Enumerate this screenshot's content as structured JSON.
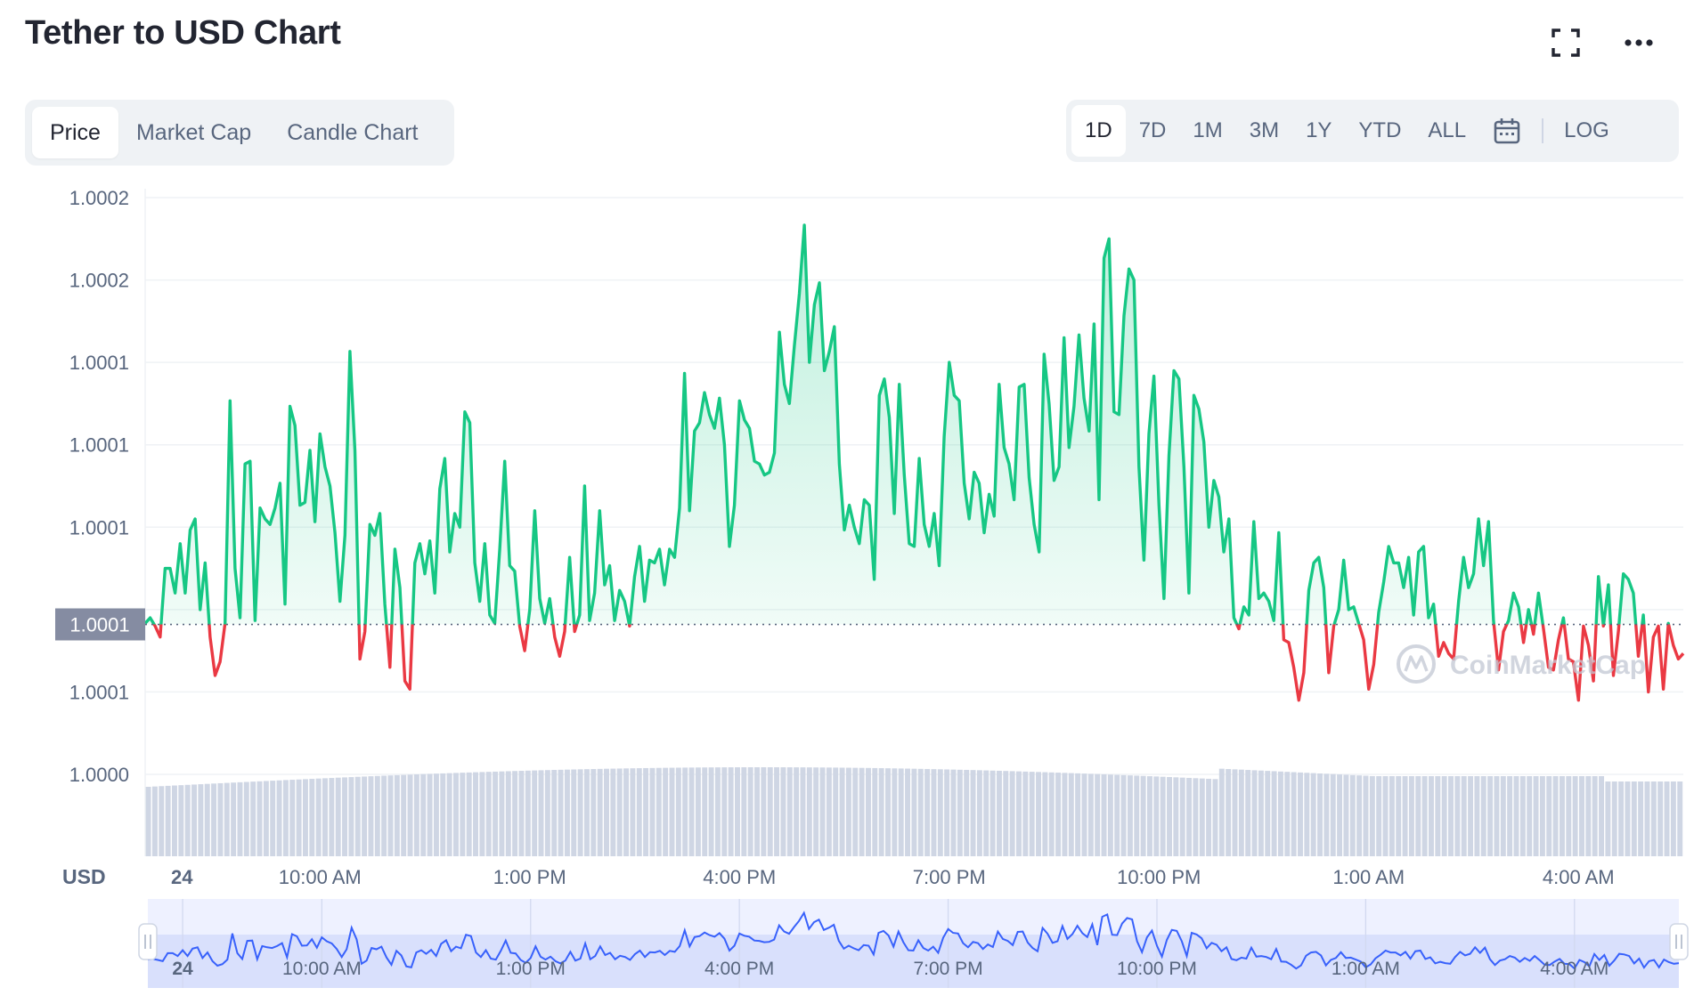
{
  "title": "Tether to USD Chart",
  "header_icons": [
    "fullscreen-icon",
    "more-options-icon"
  ],
  "tabs": [
    {
      "label": "Price",
      "active": true
    },
    {
      "label": "Market Cap",
      "active": false
    },
    {
      "label": "Candle Chart",
      "active": false
    }
  ],
  "ranges": [
    {
      "label": "1D",
      "active": true
    },
    {
      "label": "7D",
      "active": false
    },
    {
      "label": "1M",
      "active": false
    },
    {
      "label": "3M",
      "active": false
    },
    {
      "label": "1Y",
      "active": false
    },
    {
      "label": "YTD",
      "active": false
    },
    {
      "label": "ALL",
      "active": false
    }
  ],
  "range_icons": [
    "calendar-icon"
  ],
  "log_label": "LOG",
  "watermark": "CoinMarketCap",
  "colors": {
    "up": "#16c784",
    "down": "#ea3943",
    "navigator": "#3861fb",
    "volume": "#cfd6e4"
  },
  "chart_data": {
    "type": "line",
    "title": "Tether to USD Chart",
    "ylabel": "USD",
    "ylim": [
      1.0,
      1.00021
    ],
    "yticks": [
      1.0,
      1.00003,
      1.00006,
      1.00009,
      1.00012,
      1.00015,
      1.00018,
      1.00021
    ],
    "ytick_labels": [
      "1.0000",
      "1.0001",
      "",
      "1.0001",
      "1.0001",
      "1.0001",
      "1.0002",
      "1.0002"
    ],
    "baseline": 1.0000546,
    "baseline_label": "1.0001",
    "x_range": [
      7.5,
      29.5
    ],
    "x_ticks": [
      8,
      10,
      13,
      16,
      19,
      22,
      25,
      28
    ],
    "x_tick_labels": [
      "24",
      "10:00 AM",
      "1:00 PM",
      "4:00 PM",
      "7:00 PM",
      "10:00 PM",
      "1:00 AM",
      "4:00 AM"
    ],
    "grid": true,
    "series": [
      {
        "values": [
          1.000055,
          1.000057,
          1.000054,
          1.00005,
          1.000075,
          1.000075,
          1.000066,
          1.000084,
          1.000066,
          1.000089,
          1.000093,
          1.00006,
          1.000077,
          1.00005,
          1.000036,
          1.000041,
          1.000055,
          1.000136,
          1.000075,
          1.000057,
          1.000113,
          1.000114,
          1.000056,
          1.000097,
          1.000093,
          1.000091,
          1.000097,
          1.000106,
          1.000062,
          1.000134,
          1.000127,
          1.000098,
          1.000099,
          1.000118,
          1.000092,
          1.000124,
          1.000112,
          1.000105,
          1.000088,
          1.000063,
          1.000087,
          1.000154,
          1.000118,
          1.000042,
          1.000052,
          1.000091,
          1.000087,
          1.000095,
          1.000062,
          1.000039,
          1.000082,
          1.000068,
          1.000034,
          1.000031,
          1.000077,
          1.000084,
          1.000073,
          1.000085,
          1.000066,
          1.000104,
          1.000115,
          1.000081,
          1.000095,
          1.00009,
          1.000132,
          1.000128,
          1.000077,
          1.000063,
          1.000084,
          1.000058,
          1.000055,
          1.000082,
          1.000114,
          1.000076,
          1.000074,
          1.000054,
          1.000045,
          1.00006,
          1.000096,
          1.000064,
          1.000055,
          1.000064,
          1.00005,
          1.000043,
          1.000052,
          1.000079,
          1.000052,
          1.000058,
          1.000105,
          1.000056,
          1.000066,
          1.000096,
          1.000069,
          1.000076,
          1.000056,
          1.000067,
          1.000063,
          1.000054,
          1.000072,
          1.000083,
          1.000063,
          1.000078,
          1.000077,
          1.000082,
          1.000069,
          1.000082,
          1.000079,
          1.000097,
          1.000146,
          1.000096,
          1.000125,
          1.000128,
          1.000139,
          1.000131,
          1.000126,
          1.000137,
          1.00012,
          1.000083,
          1.000098,
          1.000136,
          1.000129,
          1.000126,
          1.000114,
          1.000113,
          1.000109,
          1.00011,
          1.000117,
          1.000161,
          1.000142,
          1.000135,
          1.000156,
          1.000175,
          1.0002,
          1.00015,
          1.000171,
          1.000179,
          1.000147,
          1.000154,
          1.000163,
          1.000113,
          1.000089,
          1.000098,
          1.00009,
          1.000084,
          1.0001,
          1.000098,
          1.000071,
          1.000138,
          1.000144,
          1.00013,
          1.000095,
          1.000142,
          1.000109,
          1.000084,
          1.000083,
          1.000115,
          1.000091,
          1.000083,
          1.000095,
          1.000076,
          1.000123,
          1.00015,
          1.000138,
          1.000136,
          1.000106,
          1.000093,
          1.00011,
          1.000106,
          1.000088,
          1.000102,
          1.000094,
          1.000142,
          1.000119,
          1.000113,
          1.0001,
          1.000141,
          1.000142,
          1.000108,
          1.000091,
          1.000081,
          1.000153,
          1.000135,
          1.000107,
          1.000112,
          1.000159,
          1.000119,
          1.000134,
          1.00016,
          1.000137,
          1.000125,
          1.000164,
          1.0001,
          1.000188,
          1.000195,
          1.000132,
          1.000131,
          1.000167,
          1.000184,
          1.00018,
          1.000112,
          1.000078,
          1.000124,
          1.000145,
          1.000098,
          1.000064,
          1.000116,
          1.000147,
          1.000144,
          1.000112,
          1.000066,
          1.000138,
          1.000133,
          1.000121,
          1.00009,
          1.000107,
          1.000101,
          1.000081,
          1.000093,
          1.000057,
          1.000053,
          1.000061,
          1.000058,
          1.000092,
          1.000064,
          1.000066,
          1.000063,
          1.000056,
          1.000088,
          1.000049,
          1.000048,
          1.000039,
          1.000027,
          1.000037,
          1.000067,
          1.000077,
          1.000079,
          1.000068,
          1.000037,
          1.000054,
          1.00006,
          1.000078,
          1.00006,
          1.000061,
          1.000055,
          1.000049,
          1.000031,
          1.00004,
          1.000059,
          1.00007,
          1.000083,
          1.000077,
          1.000077,
          1.000068,
          1.000079,
          1.000058,
          1.000081,
          1.000083,
          1.000057,
          1.000062,
          1.000043,
          1.000048,
          1.000044,
          1.000042,
          1.000063,
          1.000079,
          1.000068,
          1.000073,
          1.000093,
          1.000076,
          1.000092,
          1.000056,
          1.000038,
          1.000052,
          1.000056,
          1.000066,
          1.000061,
          1.000048,
          1.00006,
          1.000051,
          1.000066,
          1.000053,
          1.000039,
          1.000038,
          1.000049,
          1.000057,
          1.000042,
          1.000041,
          1.000027,
          1.000054,
          1.000047,
          1.000034,
          1.000072,
          1.000054,
          1.000069,
          1.000036,
          1.000052,
          1.000073,
          1.000071,
          1.000066,
          1.000043,
          1.000058,
          1.00003,
          1.00005,
          1.000054,
          1.000031,
          1.000055,
          1.000047,
          1.000042,
          1.000044
        ]
      }
    ]
  }
}
